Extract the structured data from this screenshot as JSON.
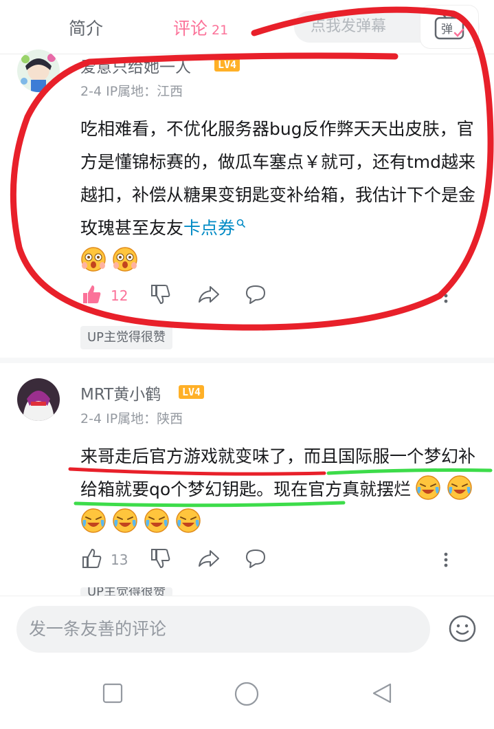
{
  "tabs": {
    "intro_label": "简介",
    "comments_label": "评论",
    "comments_count": "21"
  },
  "danmaku": {
    "placeholder": "点我发弹幕",
    "toggle_label": "弹"
  },
  "comments": [
    {
      "username": "爱意只给她一人",
      "level": "LV4",
      "date": "2-4",
      "ip_location": "IP属地：江西",
      "text": "吃相难看，不优化服务器bug反作弊天天出皮肤，官方是懂锦标赛的，做瓜车塞点￥就可，还有tmd越来越扣，补偿从糖果变钥匙变补给箱，我估计下个是金玫瑰甚至友友",
      "link_text": "卡点券",
      "likes": "12",
      "badge": "UP主觉得很赞"
    },
    {
      "username": "MRT黄小鹤",
      "level": "LV4",
      "date": "2-4",
      "ip_location": "IP属地：陕西",
      "text": "来哥走后官方游戏就变味了，而且国际服一个梦幻补给箱就要qo个梦幻钥匙。现在官方真就摆烂",
      "likes": "13",
      "badge": "UP主觉得很赞"
    }
  ],
  "reply": {
    "placeholder": "发一条友善的评论"
  },
  "colors": {
    "accent": "#fb7299",
    "link": "#008ac5",
    "level_badge": "#ffb027",
    "annotation_red": "#e8202a",
    "annotation_green": "#3ddc4a"
  },
  "icons": [
    "tv-danmaku-icon",
    "thumb-up-icon",
    "thumb-down-icon",
    "share-icon",
    "comment-icon",
    "more-vertical-icon",
    "search-icon",
    "emoji-smile-icon",
    "nav-square-icon",
    "nav-circle-icon",
    "nav-back-icon"
  ]
}
